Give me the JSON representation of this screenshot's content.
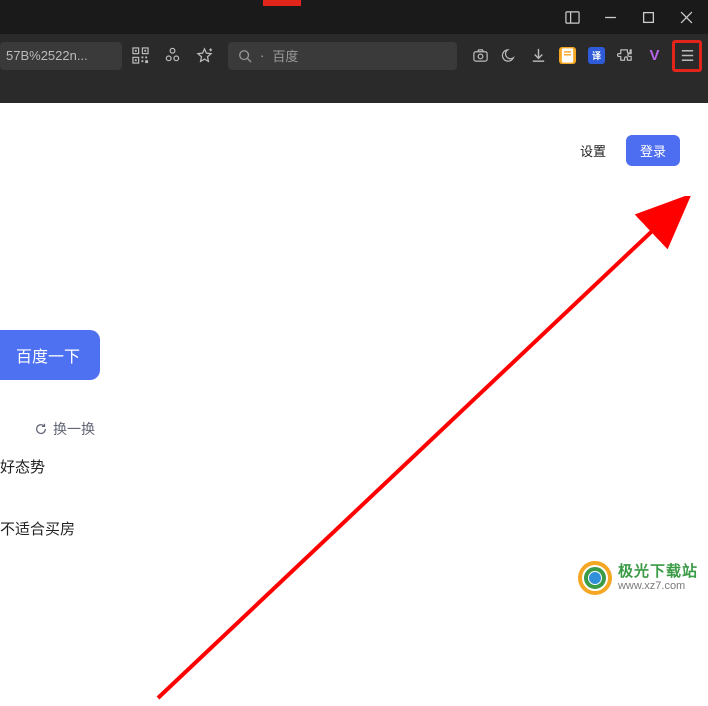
{
  "titlebar": {
    "panel_icon": "panel",
    "minimize": "minimize",
    "maximize": "maximize",
    "close": "close"
  },
  "toolbar": {
    "url_text": "57B%2522n...",
    "search_placeholder": "百度",
    "icons": {
      "qr": "qr-code",
      "addons": "addons",
      "favorite": "favorite",
      "camera": "screenshot",
      "night": "night-mode",
      "download": "download",
      "note": "note",
      "translate": "translate",
      "extension": "extension",
      "v": "V",
      "menu": "menu"
    }
  },
  "page": {
    "settings_label": "设置",
    "login_label": "登录",
    "search_button": "百度一下",
    "refresh_label": "换一换",
    "line1": "好态势",
    "line2": "不适合买房"
  },
  "watermark": {
    "title": "极光下载站",
    "url": "www.xz7.com"
  }
}
